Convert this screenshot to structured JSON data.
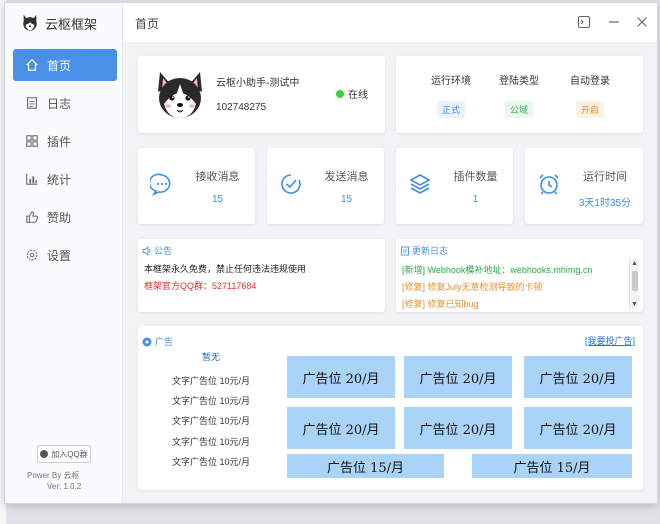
{
  "app": {
    "name": "云枢框架",
    "power": "Power By 云枢",
    "version": "Ver: 1.0.2",
    "qq_button": "加入QQ群"
  },
  "nav": [
    {
      "label": "首页",
      "icon": "home-icon",
      "active": true
    },
    {
      "label": "日志",
      "icon": "log-icon"
    },
    {
      "label": "插件",
      "icon": "plugin-icon"
    },
    {
      "label": "统计",
      "icon": "stats-icon"
    },
    {
      "label": "赞助",
      "icon": "thumbs-up-icon"
    },
    {
      "label": "设置",
      "icon": "gear-icon"
    }
  ],
  "topbar": {
    "title": "首页"
  },
  "bot": {
    "name": "云枢小助手-测试中",
    "id": "102748275",
    "status": "在线"
  },
  "env": {
    "items": [
      {
        "label": "运行环境",
        "value": "正式",
        "color": "#3b8ee6",
        "bg": "#eaf3fd"
      },
      {
        "label": "登陆类型",
        "value": "公域",
        "color": "#3bb562",
        "bg": "#eaf7ef"
      },
      {
        "label": "自动登录",
        "value": "开启",
        "color": "#e8902c",
        "bg": "#fdf1e4"
      }
    ]
  },
  "stats": [
    {
      "label": "接收消息",
      "value": "15",
      "icon": "chat-bubble-icon"
    },
    {
      "label": "发送消息",
      "value": "15",
      "icon": "check-circle-icon"
    },
    {
      "label": "插件数量",
      "value": "1",
      "icon": "layers-icon"
    },
    {
      "label": "运行时间",
      "value": "3天1时35分",
      "icon": "alarm-clock-icon"
    }
  ],
  "notice": {
    "title": "公告",
    "line1": "本框架永久免费，禁止任何违法违规使用",
    "line2": "框架官方QQ群：527117684"
  },
  "changelog": {
    "title": "更新日志",
    "entries": [
      {
        "text": "[新增] Webhook模补地址：webhooks.mhimg.cn",
        "color": "#2aa84a"
      },
      {
        "text": "[修复] 修复July无意检测导致的卡顿",
        "color": "#e8902c"
      },
      {
        "text": "[修复] 修复已知bug",
        "color": "#e8902c"
      }
    ]
  },
  "ads": {
    "title": "广告",
    "want_ad": "[我要投广告]",
    "none_label": "暂无",
    "text_ads": [
      "文字广告位 10元/月",
      "文字广告位 10元/月",
      "文字广告位 10元/月",
      "文字广告位 10元/月",
      "文字广告位 10元/月"
    ],
    "grid_ads": [
      "广告位 20/月",
      "广告位 20/月",
      "广告位 20/月",
      "广告位 20/月",
      "广告位 20/月",
      "广告位 20/月"
    ],
    "wide_ads": [
      "广告位 15/月",
      "广告位 15/月"
    ]
  }
}
